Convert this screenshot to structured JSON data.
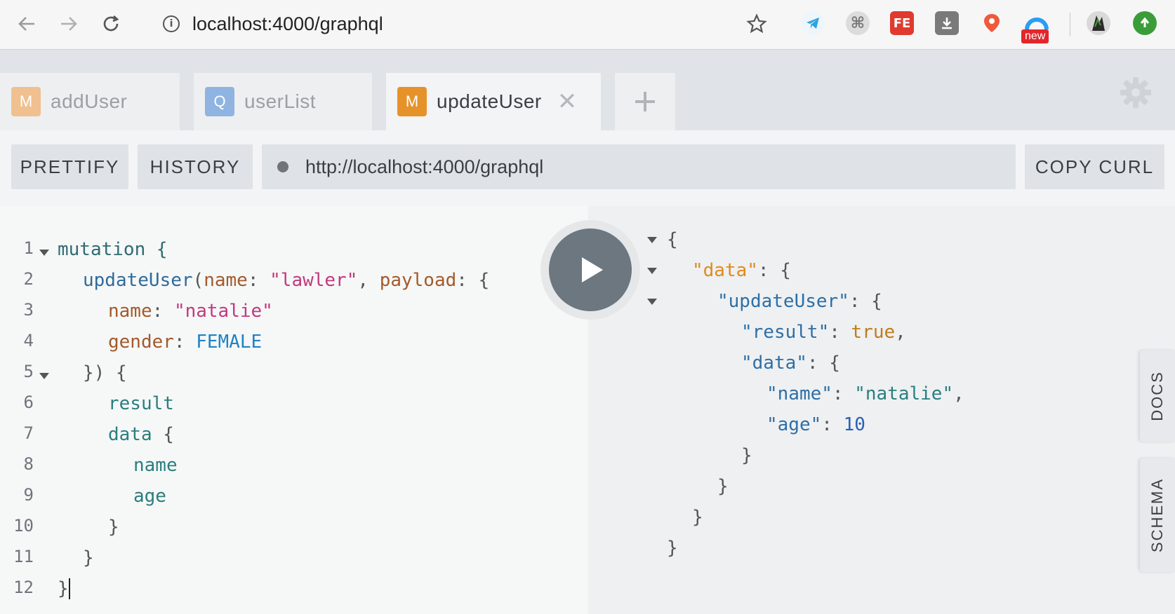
{
  "browser": {
    "url": "localhost:4000/graphql",
    "badge_new": "new"
  },
  "tabs": [
    {
      "badge": "M",
      "label": "addUser",
      "badge_color": "#f0c090"
    },
    {
      "badge": "Q",
      "label": "userList",
      "badge_color": "#8fb4e2"
    },
    {
      "badge": "M",
      "label": "updateUser",
      "badge_color": "#e6922a"
    }
  ],
  "toolbar": {
    "prettify": "PRETTIFY",
    "history": "HISTORY",
    "endpoint": "http://localhost:4000/graphql",
    "copy_curl": "COPY CURL"
  },
  "side_tabs": {
    "docs": "DOCS",
    "schema": "SCHEMA"
  },
  "editor": {
    "line_numbers": [
      "1",
      "2",
      "3",
      "4",
      "5",
      "6",
      "7",
      "8",
      "9",
      "10",
      "11",
      "12"
    ],
    "l1": "mutation {",
    "l2_fn": "updateUser",
    "l2_open": "(",
    "l2_arg1": "name",
    "l2_colon": ": ",
    "l2_str1": "\"lawler\"",
    "l2_comma": ", ",
    "l2_arg2": "payload",
    "l2_colon2": ": {",
    "l3_arg": "name",
    "l3_colon": ": ",
    "l3_str": "\"natalie\"",
    "l4_arg": "gender",
    "l4_colon": ": ",
    "l4_enum": "FEMALE",
    "l5": "}) {",
    "l6": "result",
    "l7_field": "data",
    "l7_brace": " {",
    "l8": "name",
    "l9": "age",
    "l10": "}",
    "l11": "}",
    "l12": "}"
  },
  "result": {
    "r1": "{",
    "r2_key": "\"data\"",
    "r2_rest": ": {",
    "r3_key": "\"updateUser\"",
    "r3_rest": ": {",
    "r4_key": "\"result\"",
    "r4_colon": ": ",
    "r4_val": "true",
    "r4_comma": ",",
    "r5_key": "\"data\"",
    "r5_rest": ": {",
    "r6_key": "\"name\"",
    "r6_colon": ": ",
    "r6_val": "\"natalie\"",
    "r6_comma": ",",
    "r7_key": "\"age\"",
    "r7_colon": ": ",
    "r7_val": "10",
    "r8": "}",
    "r9": "}",
    "r10": "}",
    "r11": "}"
  },
  "colors": {
    "mutation_badge": "#e6922a",
    "query_badge": "#8fb4e2",
    "play_button": "#6c7780"
  }
}
